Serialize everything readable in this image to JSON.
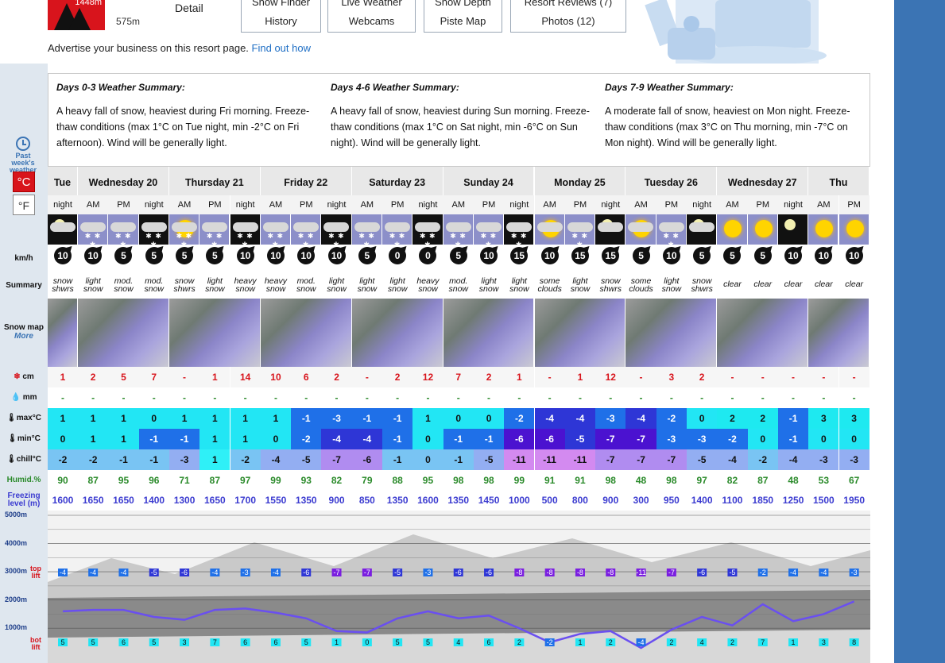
{
  "header": {
    "elevation_top": "1448m",
    "elevation_bottom": "575m",
    "detail_label": "Detail",
    "buttons": [
      {
        "line1": "Snow Finder",
        "line2": "History"
      },
      {
        "line1": "Live Weather",
        "line2": "Webcams"
      },
      {
        "line1": "Snow Depth",
        "line2": "Piste Map"
      },
      {
        "line1": "Resort Reviews (7)",
        "line2": "Photos (12)"
      }
    ],
    "advert_text": "Advertise your business on this resort page.",
    "advert_link": "Find out how"
  },
  "sidebar": {
    "past_weather": "Past week's weather",
    "unit_c": "°C",
    "unit_f": "°F",
    "labels": {
      "wind": "km/h",
      "summary": "Summary",
      "snowmap": "Snow map",
      "snowmap_more": "More",
      "snow": "cm",
      "rain": "mm",
      "max": "max°C",
      "min": "min°C",
      "chill": "chill°C",
      "humid": "Humid.%",
      "freezing": "Freezing level (m)"
    }
  },
  "summaries": [
    {
      "title": "Days 0-3 Weather Summary:",
      "text": "A heavy fall of snow, heaviest during Fri morning. Freeze-thaw conditions (max 1°C on Tue night, min -2°C on Fri afternoon). Wind will be generally light."
    },
    {
      "title": "Days 4-6 Weather Summary:",
      "text": "A heavy fall of snow, heaviest during Sun morning. Freeze-thaw conditions (max 1°C on Sat night, min -6°C on Sun night). Wind will be generally light."
    },
    {
      "title": "Days 7-9 Weather Summary:",
      "text": "A moderate fall of snow, heaviest on Mon night. Freeze-thaw conditions (max 3°C on Thu morning, min -7°C on Mon night). Wind will be generally light."
    }
  ],
  "days": [
    {
      "name": "Tue",
      "span": 1
    },
    {
      "name": "Wednesday 20",
      "span": 3
    },
    {
      "name": "Thursday 21",
      "span": 3
    },
    {
      "name": "Friday 22",
      "span": 3
    },
    {
      "name": "Saturday 23",
      "span": 3
    },
    {
      "name": "Sunday 24",
      "span": 3
    },
    {
      "name": "Monday 25",
      "span": 3
    },
    {
      "name": "Tuesday 26",
      "span": 3
    },
    {
      "name": "Wednesday 27",
      "span": 3
    },
    {
      "name": "Thu",
      "span": 2
    }
  ],
  "periods": [
    "night",
    "AM",
    "PM",
    "night",
    "AM",
    "PM",
    "night",
    "AM",
    "PM",
    "night",
    "AM",
    "PM",
    "night",
    "AM",
    "PM",
    "night",
    "AM",
    "PM",
    "night",
    "AM",
    "PM",
    "night",
    "AM",
    "PM",
    "night",
    "AM",
    "PM"
  ],
  "icons": [
    "moon-cloud",
    "snow",
    "snow",
    "snow-night",
    "sun-cloud-snow",
    "snow",
    "snow-night",
    "snow",
    "snow",
    "snow-night",
    "snow",
    "snow",
    "snow-night",
    "snow",
    "snow",
    "snow-night",
    "sun-cloud",
    "snow",
    "moon-cloud",
    "sun-cloud",
    "snow",
    "moon-cloud",
    "sun",
    "sun",
    "moon",
    "sun",
    "sun"
  ],
  "wind": [
    "10",
    "10",
    "5",
    "5",
    "5",
    "5",
    "10",
    "10",
    "10",
    "10",
    "5",
    "0",
    "0",
    "5",
    "10",
    "15",
    "10",
    "15",
    "15",
    "5",
    "10",
    "5",
    "5",
    "5",
    "10",
    "10",
    "10"
  ],
  "summary": [
    [
      "snow",
      "shwrs"
    ],
    [
      "light",
      "snow"
    ],
    [
      "mod.",
      "snow"
    ],
    [
      "mod.",
      "snow"
    ],
    [
      "snow",
      "shwrs"
    ],
    [
      "light",
      "snow"
    ],
    [
      "heavy",
      "snow"
    ],
    [
      "heavy",
      "snow"
    ],
    [
      "mod.",
      "snow"
    ],
    [
      "light",
      "snow"
    ],
    [
      "light",
      "snow"
    ],
    [
      "light",
      "snow"
    ],
    [
      "heavy",
      "snow"
    ],
    [
      "mod.",
      "snow"
    ],
    [
      "light",
      "snow"
    ],
    [
      "light",
      "snow"
    ],
    [
      "some",
      "clouds"
    ],
    [
      "light",
      "snow"
    ],
    [
      "snow",
      "shwrs"
    ],
    [
      "some",
      "clouds"
    ],
    [
      "light",
      "snow"
    ],
    [
      "snow",
      "shwrs"
    ],
    [
      "clear",
      ""
    ],
    [
      "clear",
      ""
    ],
    [
      "clear",
      ""
    ],
    [
      "clear",
      ""
    ],
    [
      "clear",
      ""
    ]
  ],
  "snow": [
    "1",
    "2",
    "5",
    "7",
    "-",
    "1",
    "14",
    "10",
    "6",
    "2",
    "-",
    "2",
    "12",
    "7",
    "2",
    "1",
    "-",
    "1",
    "12",
    "-",
    "3",
    "2",
    "-",
    "-",
    "-",
    "-",
    "-"
  ],
  "rain": [
    "-",
    "-",
    "-",
    "-",
    "-",
    "-",
    "-",
    "-",
    "-",
    "-",
    "-",
    "-",
    "-",
    "-",
    "-",
    "-",
    "-",
    "-",
    "-",
    "-",
    "-",
    "-",
    "-",
    "-",
    "-",
    "-",
    "-"
  ],
  "max": [
    1,
    1,
    1,
    0,
    1,
    1,
    1,
    1,
    -1,
    -3,
    -1,
    -1,
    1,
    0,
    0,
    -2,
    -4,
    -4,
    -3,
    -4,
    -2,
    0,
    2,
    2,
    -1,
    3,
    3
  ],
  "min": [
    0,
    1,
    1,
    -1,
    -1,
    1,
    1,
    0,
    -2,
    -4,
    -4,
    -1,
    0,
    -1,
    -1,
    -6,
    -6,
    -5,
    -7,
    -7,
    -3,
    -3,
    -2,
    0,
    -1,
    0,
    0
  ],
  "chill": [
    -2,
    -2,
    -1,
    -1,
    -3,
    1,
    -2,
    -4,
    -5,
    -7,
    -6,
    -1,
    0,
    -1,
    -5,
    -11,
    -11,
    -11,
    -7,
    -7,
    -7,
    -5,
    -4,
    -2,
    -4,
    -3,
    -3
  ],
  "humid": [
    "90",
    "87",
    "95",
    "96",
    "71",
    "87",
    "97",
    "99",
    "93",
    "82",
    "79",
    "88",
    "95",
    "98",
    "98",
    "99",
    "91",
    "91",
    "98",
    "48",
    "98",
    "97",
    "82",
    "87",
    "48",
    "53",
    "67"
  ],
  "freezing": [
    1600,
    1650,
    1650,
    1400,
    1300,
    1650,
    1700,
    1550,
    1350,
    900,
    850,
    1350,
    1600,
    1350,
    1450,
    1000,
    500,
    800,
    900,
    300,
    950,
    1400,
    1100,
    1850,
    1250,
    1500,
    1950
  ],
  "chart": {
    "y_labels": [
      "5000m",
      "4000m",
      "3000m",
      "2000m",
      "1000m"
    ],
    "top_lift": "top lift",
    "bot_lift": "bot lift",
    "top_temps": [
      "-4",
      "-4",
      "-4",
      "-5",
      "-6",
      "-4",
      "-3",
      "-4",
      "-6",
      "-7",
      "-7",
      "-5",
      "-3",
      "-6",
      "-6",
      "-8",
      "-8",
      "-8",
      "-8",
      "-11",
      "-7",
      "-6",
      "-5",
      "-2",
      "-4",
      "-4",
      "-3"
    ],
    "bot_temps": [
      "5",
      "5",
      "6",
      "5",
      "3",
      "7",
      "6",
      "6",
      "5",
      "1",
      "0",
      "5",
      "5",
      "4",
      "6",
      "2",
      "-2",
      "1",
      "2",
      "-4",
      "2",
      "4",
      "2",
      "7",
      "1",
      "3",
      "8"
    ]
  },
  "colors": {
    "accent_blue": "#3b74b4",
    "logo_red": "#d8141c",
    "link": "#1f6fc5"
  }
}
